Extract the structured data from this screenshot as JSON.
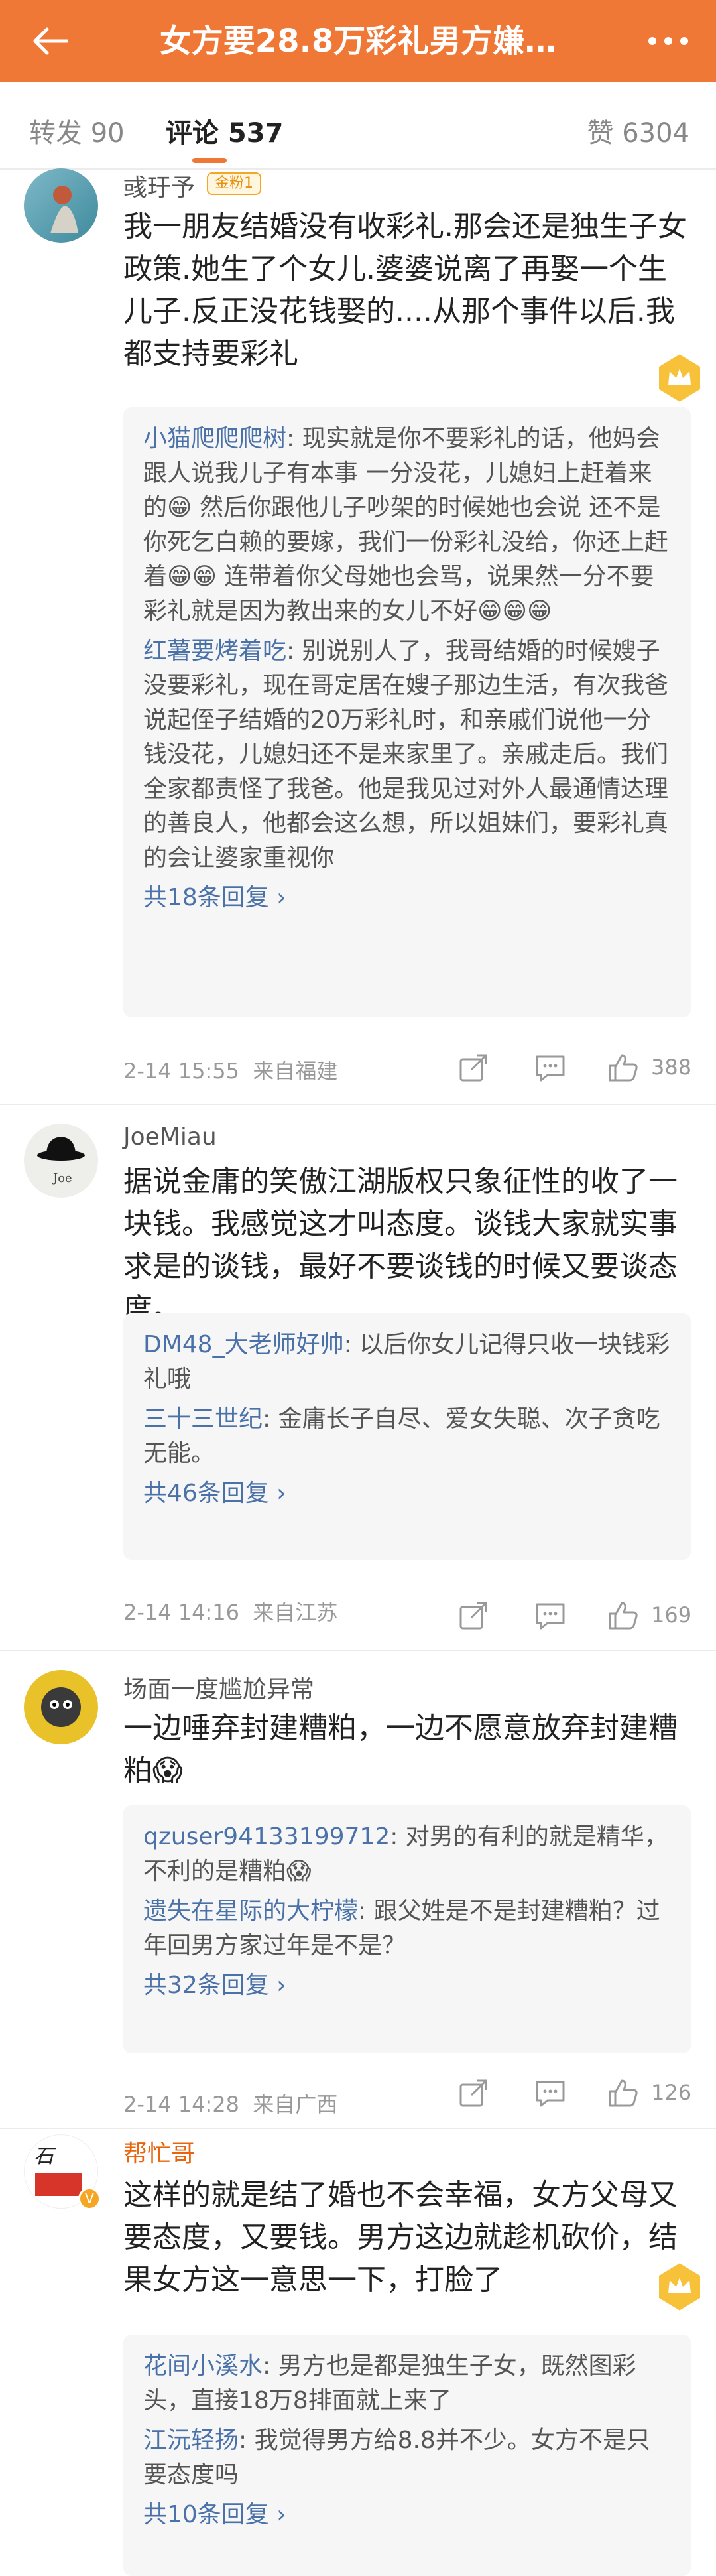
{
  "header": {
    "title": "女方要28.8万彩礼男方嫌…",
    "tabs": {
      "repost": "转发 90",
      "comments": "评论 537",
      "likes": "赞 6304"
    }
  },
  "colors": {
    "brand": "#f07836",
    "link": "#4a72a8",
    "muted": "#999999"
  },
  "comments": [
    {
      "user": "彧玗予",
      "badge": "金粉1",
      "text": "我一朋友结婚没有收彩礼.那会还是独生子女政策.她生了个女儿.婆婆说离了再娶一个生儿子.反正没花钱娶的....从那个事件以后.我都支持要彩礼",
      "replies": [
        {
          "name": "小猫爬爬爬树",
          "text": ": 现实就是你不要彩礼的话，他妈会跟人说我儿子有本事 一分没花，儿媳妇上赶着来的😁 然后你跟他儿子吵架的时候她也会说 还不是你死乞白赖的要嫁，我们一份彩礼没给，你还上赶着😁😁 连带着你父母她也会骂，说果然一分不要彩礼就是因为教出来的女儿不好😁😁😁"
        },
        {
          "name": "红薯要烤着吃",
          "text": ": 别说别人了，我哥结婚的时候嫂子没要彩礼，现在哥定居在嫂子那边生活，有次我爸说起侄子结婚的20万彩礼时，和亲戚们说他一分钱没花，儿媳妇还不是来家里了。亲戚走后。我们全家都责怪了我爸。他是我见过对外人最通情达理的善良人，他都会这么想，所以姐妹们，要彩礼真的会让婆家重视你"
        }
      ],
      "more": "共18条回复 ›",
      "time": "2-14 15:55",
      "location": "来自福建",
      "likes": "388"
    },
    {
      "user": "JoeMiau",
      "text": "据说金庸的笑傲江湖版权只象征性的收了一块钱。我感觉这才叫态度。谈钱大家就实事求是的谈钱，最好不要谈钱的时候又要谈态度。",
      "replies": [
        {
          "name": "DM48_大老师好帅",
          "text": ": 以后你女儿记得只收一块钱彩礼哦"
        },
        {
          "name": "三十三世纪",
          "text": ": 金庸长子自尽、爱女失聪、次子贪吃无能。"
        }
      ],
      "more": "共46条回复 ›",
      "time": "2-14 14:16",
      "location": "来自江苏",
      "likes": "169"
    },
    {
      "user": "场面一度尴尬异常",
      "text": "一边唾弃封建糟粕，一边不愿意放弃封建糟粕😱",
      "replies": [
        {
          "name": "qzuser94133199712",
          "text": ": 对男的有利的就是精华，不利的是糟粕😱"
        },
        {
          "name": "遗失在星际的大柠檬",
          "text": ": 跟父姓是不是封建糟粕？过年回男方家过年是不是？"
        }
      ],
      "more": "共32条回复 ›",
      "time": "2-14 14:28",
      "location": "来自广西",
      "likes": "126"
    },
    {
      "user": "帮忙哥",
      "text": "这样的就是结了婚也不会幸福，女方父母又要态度，又要钱。男方这边就趁机砍价，结果女方这一意思一下，打脸了",
      "replies": [
        {
          "name": "花间小溪水",
          "text": ": 男方也是都是独生子女，既然图彩头，直接18万8排面就上来了"
        },
        {
          "name": "江沅轻扬",
          "text": ": 我觉得男方给8.8并不少。女方不是只要态度吗"
        }
      ],
      "more": "共10条回复 ›"
    }
  ]
}
